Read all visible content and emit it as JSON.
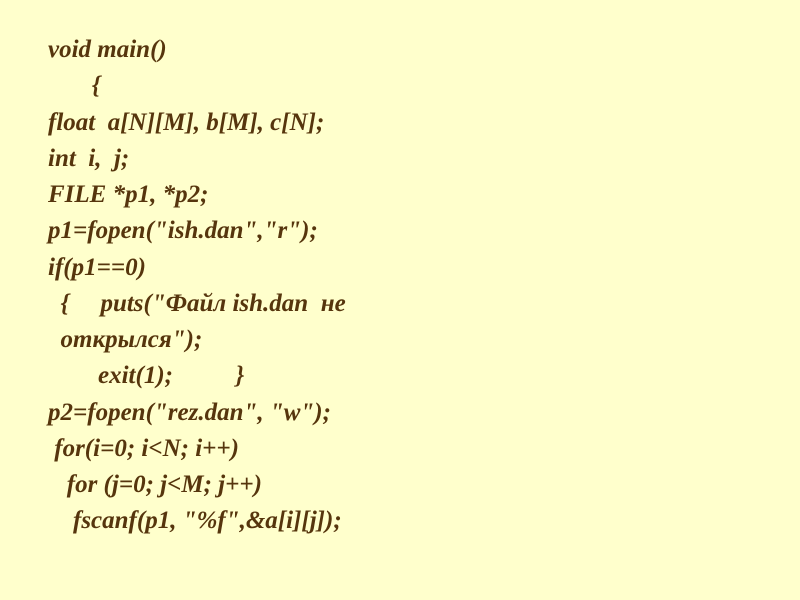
{
  "code": {
    "lines": [
      "void main()",
      "       {",
      "float  a[N][M], b[M], c[N];",
      "int  i,  j;",
      "FILE *p1, *p2;",
      "p1=fopen(\"ish.dan\",\"r\");",
      "if(p1==0)",
      "  {     puts(\"Файл ish.dan  не",
      "  открылся\");",
      "        exit(1);          }",
      "p2=fopen(\"rez.dan\", \"w\");",
      " for(i=0; i<N; i++)",
      "   for (j=0; j<M; j++)",
      "    fscanf(p1, \"%f\",&a[i][j]);"
    ]
  }
}
